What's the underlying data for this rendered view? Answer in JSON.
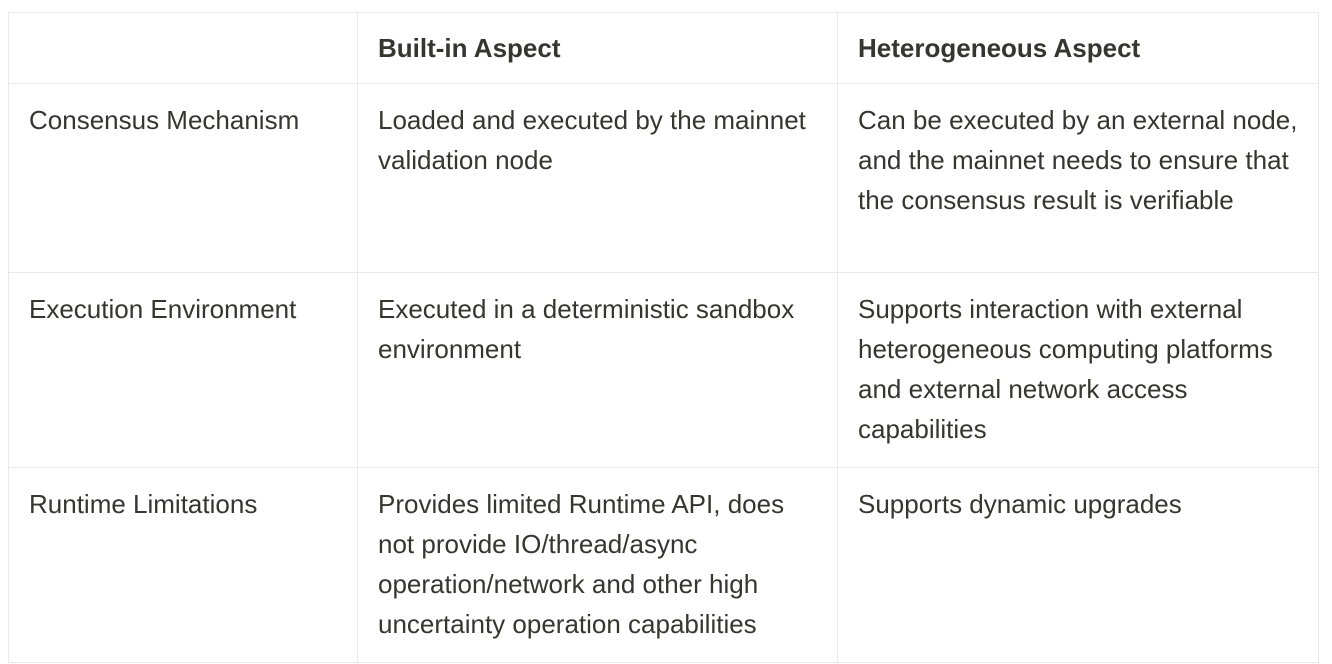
{
  "table": {
    "columns": [
      "",
      "Built-in Aspect",
      "Heterogeneous Aspect"
    ],
    "rows": [
      {
        "label": "Consensus Mechanism",
        "builtin": "Loaded and executed by the mainnet validation node",
        "heterogeneous": "Can be executed by an external node, and the mainnet needs to ensure that the consensus result is verifiable"
      },
      {
        "label": "Execution Environment",
        "builtin": "Executed in a deterministic sandbox environment",
        "heterogeneous": "Supports interaction with external heterogeneous computing platforms and external network access capabilities"
      },
      {
        "label": "Runtime Limitations",
        "builtin": "Provides limited Runtime API, does not provide IO/thread/async operation/network and other high uncertainty operation capabilities",
        "heterogeneous": "Supports dynamic upgrades"
      }
    ]
  }
}
